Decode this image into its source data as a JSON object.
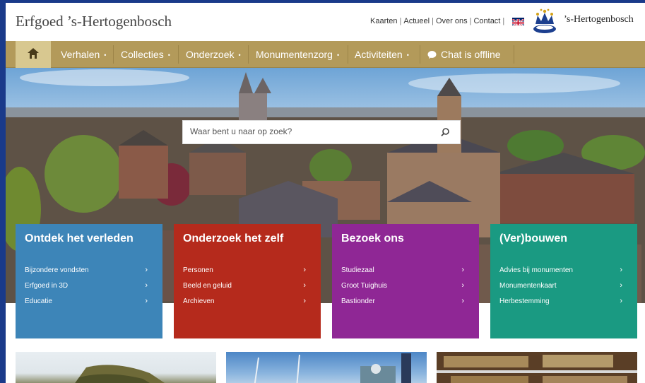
{
  "header": {
    "site_title": "Erfgoed ’s-Hertogenbosch",
    "links": [
      "Kaarten",
      "Actueel",
      "Over ons",
      "Contact"
    ],
    "brand": "’s-Hertogenbosch"
  },
  "nav": {
    "items": [
      {
        "label": "Verhalen",
        "dot": "•"
      },
      {
        "label": "Collecties",
        "dot": "•"
      },
      {
        "label": "Onderzoek",
        "dot": "•"
      },
      {
        "label": "Monumentenzorg",
        "dot": "•"
      },
      {
        "label": "Activiteiten",
        "dot": "•"
      }
    ],
    "chat_label": "Chat is offline"
  },
  "search": {
    "placeholder": "Waar bent u naar op zoek?"
  },
  "cards": [
    {
      "title": "Ontdek het verleden",
      "color": "#3d85b8",
      "links": [
        "Bijzondere vondsten",
        "Erfgoed in 3D",
        "Educatie"
      ]
    },
    {
      "title": "Onderzoek het zelf",
      "color": "#b52a1c",
      "links": [
        "Personen",
        "Beeld en geluid",
        "Archieven"
      ]
    },
    {
      "title": "Bezoek ons",
      "color": "#8f2795",
      "links": [
        "Studiezaal",
        "Groot Tuighuis",
        "Bastionder"
      ]
    },
    {
      "title": "(Ver)bouwen",
      "color": "#1a9a82",
      "links": [
        "Advies bij monumenten",
        "Monumentenkaart",
        "Herbestemming"
      ]
    }
  ],
  "icons": {
    "chevron": "›"
  }
}
